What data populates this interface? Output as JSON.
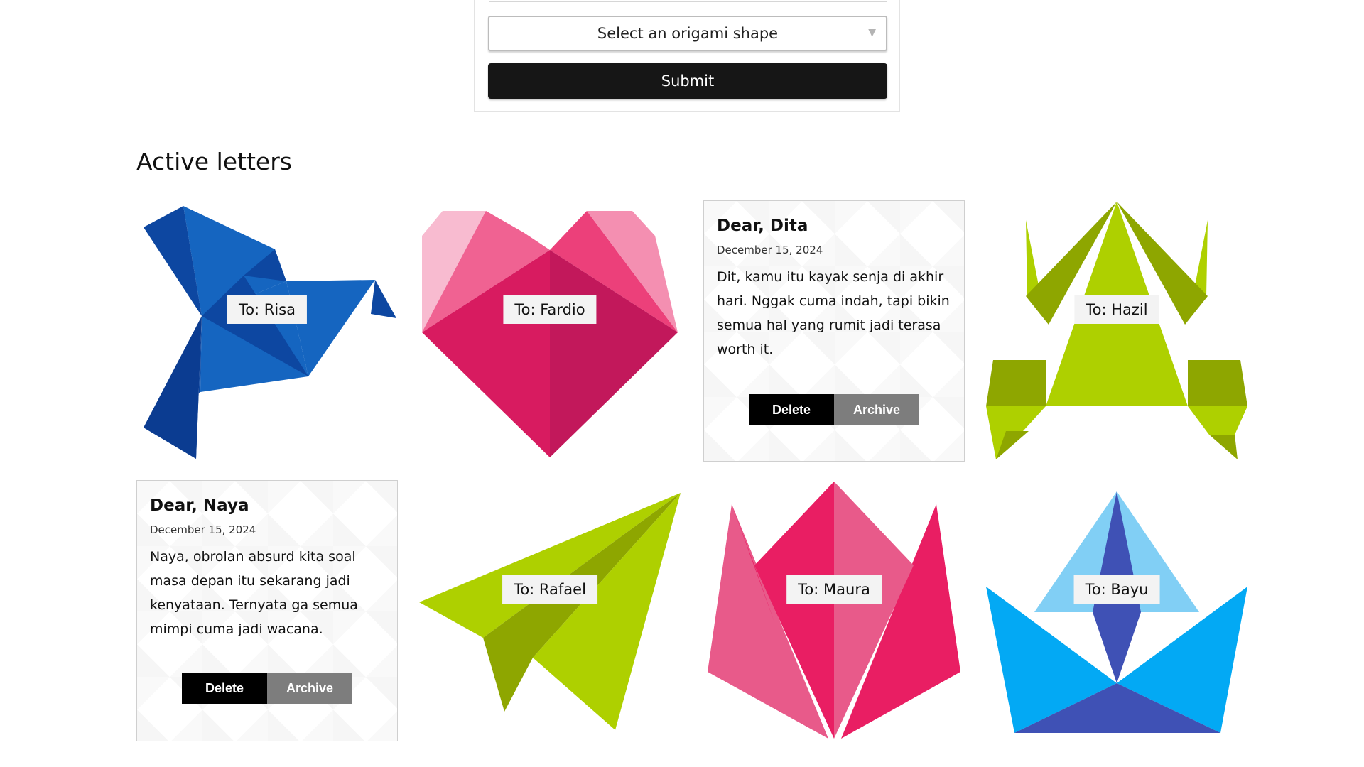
{
  "form": {
    "select_placeholder": "Select an origami shape",
    "submit_label": "Submit"
  },
  "section_title": "Active letters",
  "letters": [
    {
      "to": "To: Risa",
      "shape": "bird-icon"
    },
    {
      "to": "To: Fardio",
      "shape": "heart-icon"
    },
    {
      "open": true,
      "heading": "Dear, Dita",
      "date": "December 15, 2024",
      "body": "Dit, kamu itu kayak senja di akhir hari. Nggak cuma indah, tapi bikin semua hal yang rumit jadi terasa worth it.",
      "delete_label": "Delete",
      "archive_label": "Archive"
    },
    {
      "to": "To: Hazil",
      "shape": "frog-icon"
    },
    {
      "open": true,
      "heading": "Dear, Naya",
      "date": "December 15, 2024",
      "body": "Naya, obrolan absurd kita soal masa depan itu sekarang jadi kenyataan. Ternyata ga semua mimpi cuma jadi wacana.",
      "delete_label": "Delete",
      "archive_label": "Archive"
    },
    {
      "to": "To: Rafael",
      "shape": "paper-plane-icon"
    },
    {
      "to": "To: Maura",
      "shape": "tulip-icon"
    },
    {
      "to": "To: Bayu",
      "shape": "boat-icon"
    }
  ],
  "colors": {
    "bird": "#1565c0",
    "heart": "#d81b60",
    "frog": "#aed000",
    "plane": "#aed000",
    "tulip": "#e91e63",
    "boat": "#03a9f4",
    "delete_button": "#000000",
    "archive_button": "#7d7d7d"
  }
}
